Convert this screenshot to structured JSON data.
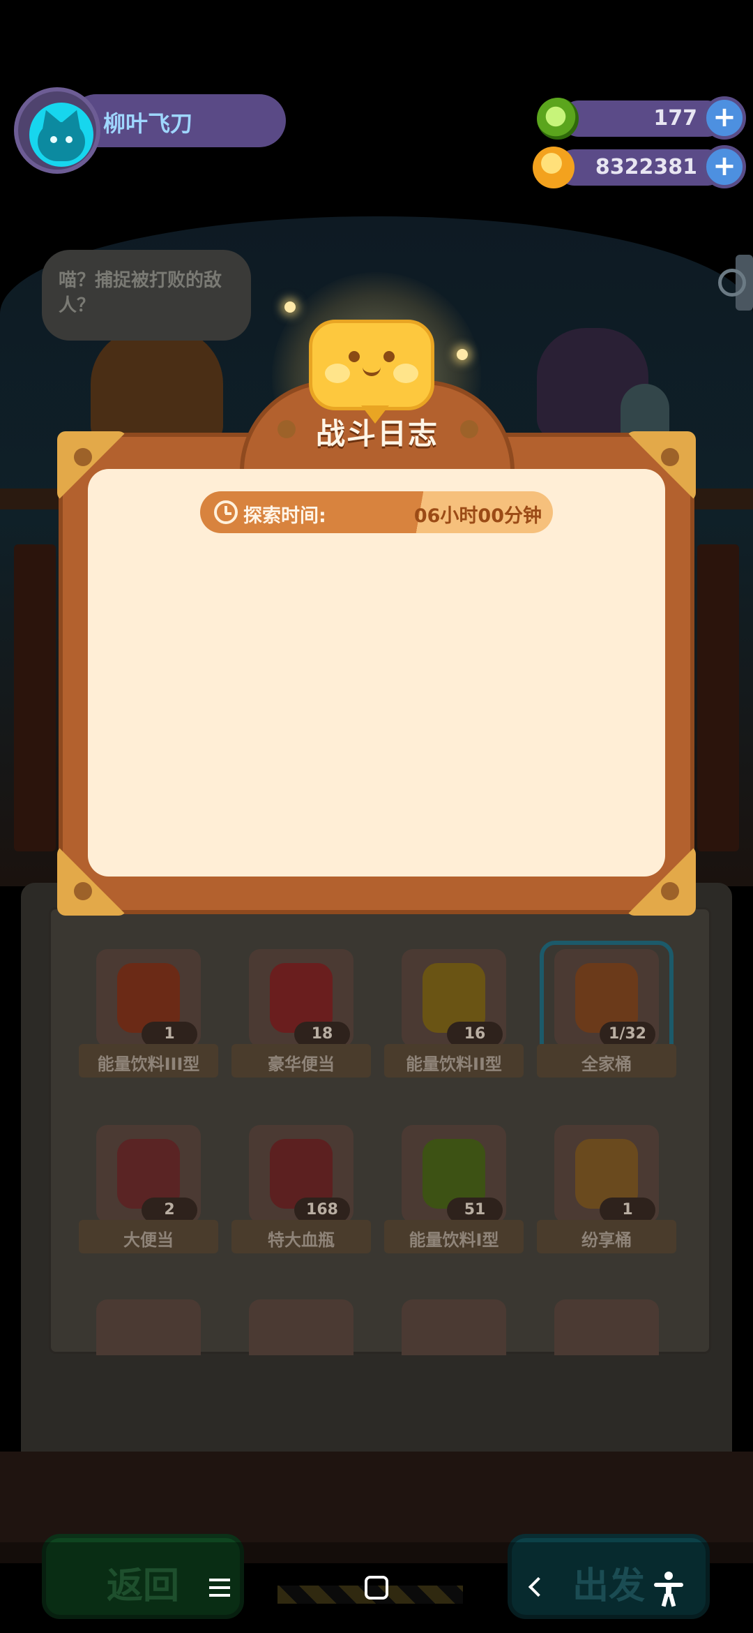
{
  "player": {
    "name": "柳叶飞刀"
  },
  "currencies": [
    {
      "value": "177",
      "icon": "donut-coin-icon",
      "color": "#5ba51d"
    },
    {
      "value": "8322381",
      "icon": "planet-coin-icon",
      "color": "#f3a21e"
    }
  ],
  "npc": {
    "speech": "喵？捕捉被打败的敌人？"
  },
  "dialog": {
    "title": "战斗日志",
    "explore_label": "探索时间:",
    "explore_value": "06小时00分钟"
  },
  "items": [
    {
      "label": "能量饮料III型",
      "count": "1"
    },
    {
      "label": "豪华便当",
      "count": "18"
    },
    {
      "label": "能量饮料II型",
      "count": "16"
    },
    {
      "label": "全家桶",
      "count": "1/32",
      "selected": true
    },
    {
      "label": "大便当",
      "count": "2"
    },
    {
      "label": "特大血瓶",
      "count": "168"
    },
    {
      "label": "能量饮料I型",
      "count": "51"
    },
    {
      "label": "纷享桶",
      "count": "1"
    }
  ],
  "buttons": {
    "back": "返回",
    "depart": "出发"
  },
  "colors": {
    "dialog_frame": "#b3612e",
    "dialog_paper": "#ffeed6",
    "mascot": "#fdc83e",
    "profile_bar": "#5a4a86"
  }
}
